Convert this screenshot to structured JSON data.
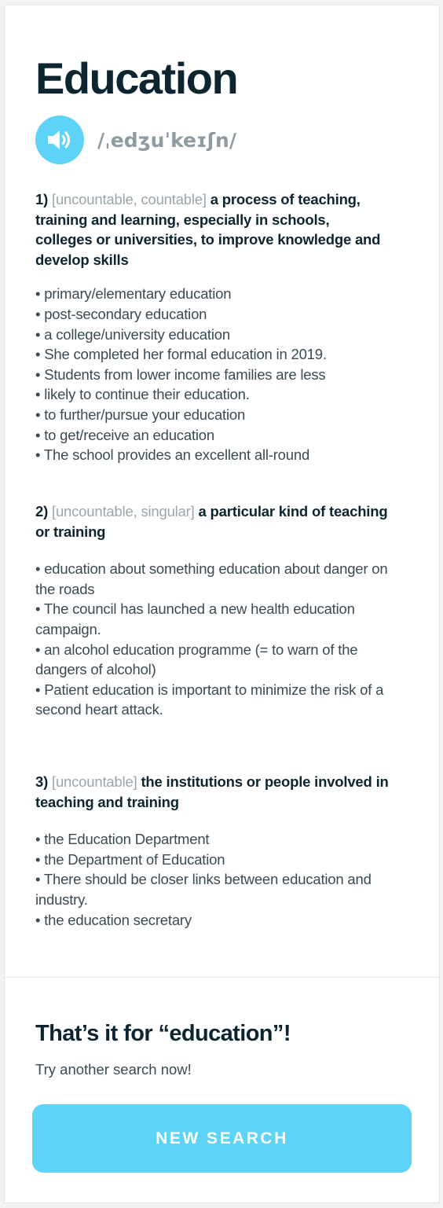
{
  "entry": {
    "word": "Education",
    "pronunciation": "/ˌedʒuˈkeɪʃn/",
    "audio_icon": "speaker-icon"
  },
  "senses": [
    {
      "number": "1)",
      "grammar": "[uncountable, countable]",
      "definition": "a process of teaching, training and learning, especially in schools, colleges or universities, to improve knowledge and develop skills",
      "examples": [
        "• primary/elementary education",
        "• post-secondary education",
        "• a college/university education",
        "• She completed her formal education in 2019.",
        "• Students from lower income families are less",
        "• likely to continue their education.",
        "• to further/pursue your education",
        "• to get/receive an education",
        "• The school provides an excellent all-round"
      ]
    },
    {
      "number": "2)",
      "grammar": "[uncountable, singular]",
      "definition": "a particular kind of teaching or training",
      "examples": [
        "• education about something education about danger on the roads",
        "• The council has launched a new health education campaign.",
        "• an alcohol education programme (= to warn of the dangers of alcohol)",
        "• Patient education is important to minimize the risk of a second heart attack."
      ]
    },
    {
      "number": "3)",
      "grammar": "[uncountable]",
      "definition": "the institutions or people involved in teaching and training",
      "examples": [
        "• the Education Department",
        "• the Department of Education",
        "• There should be closer links between education and industry.",
        "• the education secretary"
      ]
    }
  ],
  "footer": {
    "title": "That’s it for “education”!",
    "subtitle": "Try another search now!",
    "button_label": "NEW SEARCH"
  },
  "colors": {
    "accent": "#5dd3f8",
    "heading": "#0d2530",
    "grammar": "#9aa5aa",
    "body_text": "#3b4a52"
  }
}
